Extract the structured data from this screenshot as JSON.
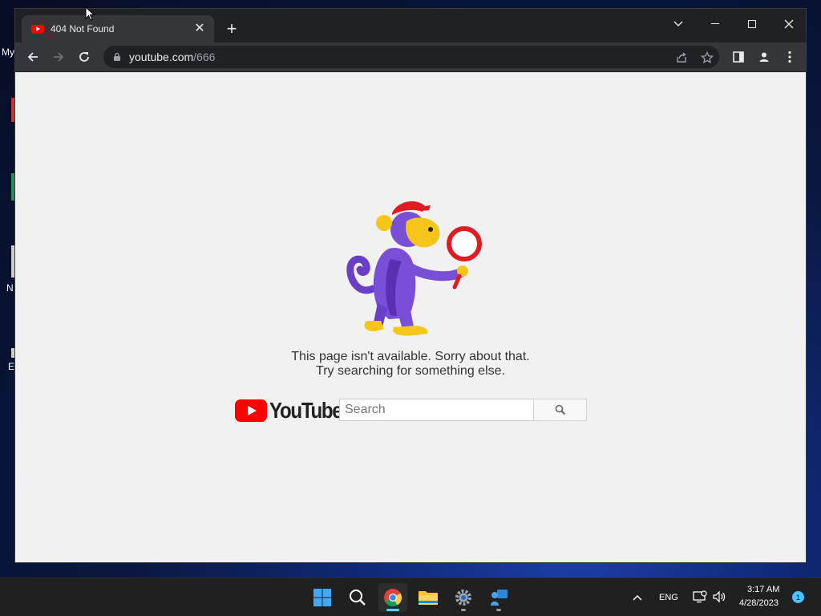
{
  "desktop": {
    "fragments": [
      "My",
      "N",
      "E"
    ]
  },
  "browser": {
    "tab": {
      "title": "404 Not Found",
      "favicon": "youtube-icon"
    },
    "address": {
      "host": "youtube.com",
      "path": "/666"
    },
    "icons": {
      "back": "back-arrow-icon",
      "forward": "forward-arrow-icon",
      "reload": "reload-icon",
      "lock": "lock-icon",
      "share": "share-icon",
      "bookmark": "star-icon",
      "side_panel": "side-panel-icon",
      "profile": "profile-icon",
      "menu": "kebab-menu-icon"
    }
  },
  "page": {
    "message_line1": "This page isn't available. Sorry about that.",
    "message_line2": "Try searching for something else.",
    "logo_text": "YouTube",
    "search_placeholder": "Search",
    "search_button_icon": "search-icon",
    "colors": {
      "background": "#f1f1f1",
      "brand_red": "#ff0000",
      "text": "#333333"
    }
  },
  "taskbar": {
    "apps": [
      "start-icon",
      "search-icon",
      "chrome-icon",
      "file-explorer-icon",
      "settings-icon",
      "teams-icon"
    ],
    "language": "ENG",
    "time": "3:17 AM",
    "date": "4/28/2023",
    "notification_count": "1"
  }
}
